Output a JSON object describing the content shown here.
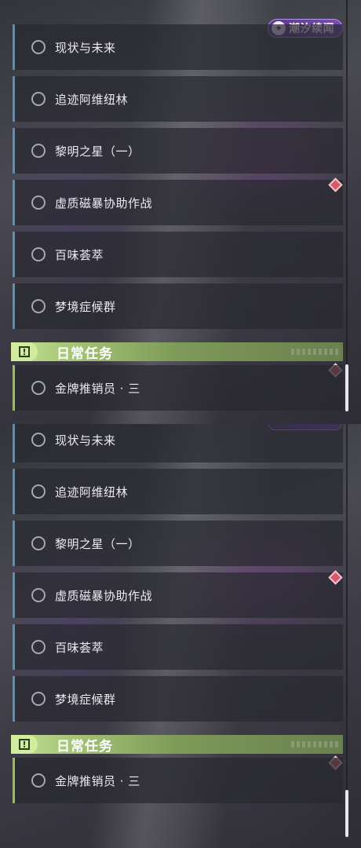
{
  "colors": {
    "accent_green": "#a9c97a",
    "item_border": "#6d8ba0",
    "tracked_diamond": "#d65a6a",
    "logo_purple": "#6a45a0"
  },
  "logo": {
    "text": "潮汐续闻",
    "icon": "tide-swirl-icon"
  },
  "panels": [
    {
      "quests": [
        {
          "label": "现状与未来",
          "tracked": false
        },
        {
          "label": "追迹阿维纽林",
          "tracked": false
        },
        {
          "label": "黎明之星（一）",
          "tracked": false
        },
        {
          "label": "虚质磁暴协助作战",
          "tracked": true
        },
        {
          "label": "百味荟萃",
          "tracked": false
        },
        {
          "label": "梦境症候群",
          "tracked": false
        }
      ],
      "category": {
        "title": "日常任务",
        "icon": "exclamation-box-icon"
      },
      "daily_quests": [
        {
          "label": "金牌推销员 · 三",
          "tracked": true
        }
      ]
    },
    {
      "quests": [
        {
          "label": "现状与未来",
          "tracked": false
        },
        {
          "label": "追迹阿维纽林",
          "tracked": false
        },
        {
          "label": "黎明之星（一）",
          "tracked": false
        },
        {
          "label": "虚质磁暴协助作战",
          "tracked": true
        },
        {
          "label": "百味荟萃",
          "tracked": false
        },
        {
          "label": "梦境症候群",
          "tracked": false
        }
      ],
      "category": {
        "title": "日常任务",
        "icon": "exclamation-box-icon"
      },
      "daily_quests": [
        {
          "label": "金牌推销员 · 三",
          "tracked": true
        }
      ]
    }
  ]
}
